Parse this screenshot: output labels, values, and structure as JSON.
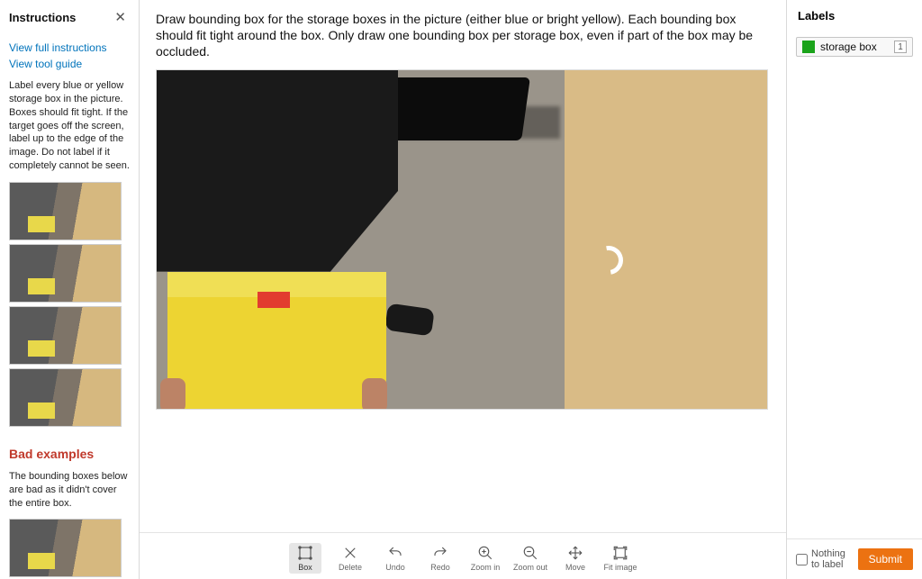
{
  "instructions": {
    "title": "Instructions",
    "view_full": "View full instructions",
    "view_tool": "View tool guide",
    "body": "Label every blue or yellow storage box in the picture. Boxes should fit tight. If the target goes off the screen, label up to the edge of the image. Do not label if it completely cannot be seen.",
    "bad_title": "Bad examples",
    "bad_body": "The bounding boxes below are bad as it didn't cover the entire box."
  },
  "prompt": "Draw bounding box for the storage boxes in the picture (either blue or bright yellow). Each bounding box should fit tight around the box. Only draw one bounding box per storage box, even if part of the box may be occluded.",
  "toolbar": {
    "box": "Box",
    "delete": "Delete",
    "undo": "Undo",
    "redo": "Redo",
    "zoom_in": "Zoom in",
    "zoom_out": "Zoom out",
    "move": "Move",
    "fit": "Fit image"
  },
  "labels": {
    "title": "Labels",
    "items": [
      {
        "name": "storage box",
        "key": "1",
        "color": "#1aa31a"
      }
    ],
    "nothing_to_label": "Nothing to label",
    "submit": "Submit"
  }
}
